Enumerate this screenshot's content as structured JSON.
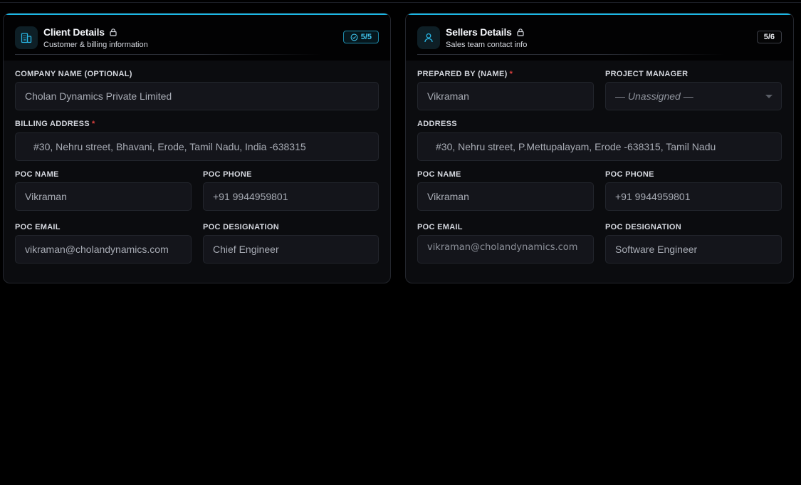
{
  "client": {
    "title": "Client Details",
    "subtitle": "Customer & billing information",
    "badge": "5/5",
    "fields": {
      "company_label": "COMPANY NAME (OPTIONAL)",
      "company_value": "Cholan Dynamics Private Limited",
      "billing_label": "BILLING ADDRESS",
      "billing_value": "#30, Nehru street, Bhavani, Erode, Tamil Nadu, India -638315",
      "poc_name_label": "POC NAME",
      "poc_name_value": "Vikraman",
      "poc_phone_label": "POC PHONE",
      "poc_phone_value": "+91 9944959801",
      "poc_email_label": "POC EMAIL",
      "poc_email_value": "vikraman@cholandynamics.com",
      "poc_designation_label": "POC DESIGNATION",
      "poc_designation_value": "Chief Engineer"
    }
  },
  "sellers": {
    "title": "Sellers Details",
    "subtitle": "Sales team contact info",
    "badge": "5/6",
    "fields": {
      "prepared_by_label": "PREPARED BY (NAME)",
      "prepared_by_value": "Vikraman",
      "project_manager_label": "PROJECT MANAGER",
      "project_manager_value": "— Unassigned —",
      "address_label": "ADDRESS",
      "address_value": "#30, Nehru street, P.Mettupalayam, Erode -638315, Tamil Nadu",
      "poc_name_label": "POC NAME",
      "poc_name_value": "Vikraman",
      "poc_phone_label": "POC PHONE",
      "poc_phone_value": "+91 9944959801",
      "poc_email_label": "POC EMAIL",
      "poc_email_value": "vikraman@cholandynamics.com",
      "poc_designation_label": "POC DESIGNATION",
      "poc_designation_value": "Software Engineer"
    }
  },
  "required_mark": "*",
  "colors": {
    "accent": "#19b8e6",
    "required": "#e0413f"
  },
  "icons": {
    "client": "building-icon",
    "sellers": "user-icon",
    "lock": "lock-icon",
    "check": "check-circle-icon"
  }
}
